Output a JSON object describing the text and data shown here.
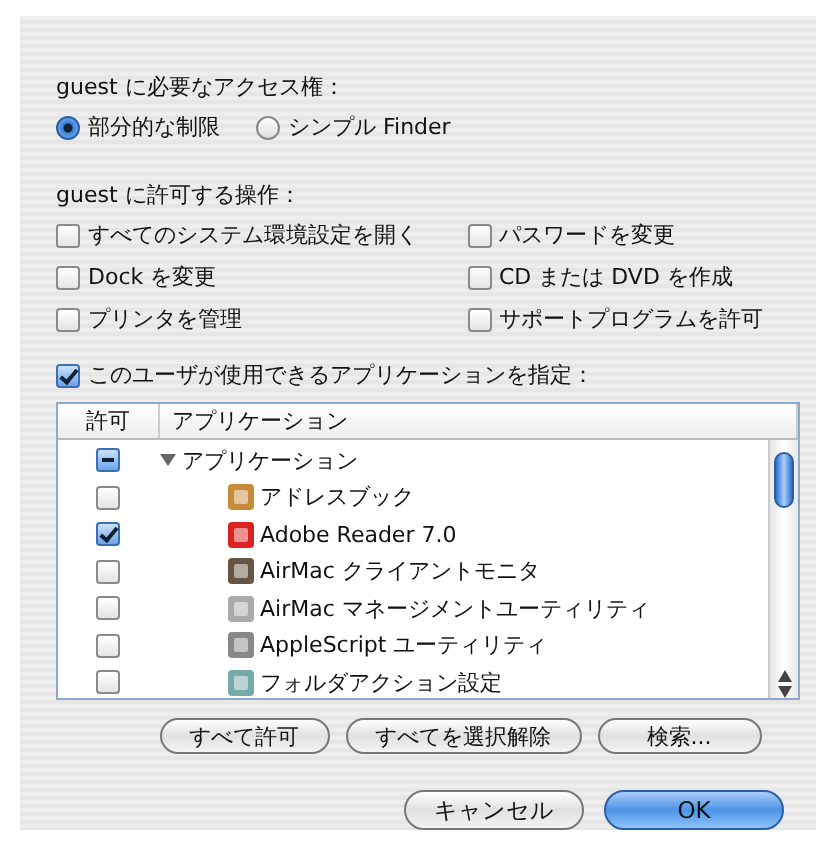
{
  "access": {
    "label": "guest に必要なアクセス権：",
    "options": [
      {
        "label": "部分的な制限",
        "selected": true
      },
      {
        "label": "シンプル Finder",
        "selected": false
      }
    ]
  },
  "permissions": {
    "label": "guest に許可する操作：",
    "items": [
      {
        "label": "すべてのシステム環境設定を開く",
        "checked": false
      },
      {
        "label": "パスワードを変更",
        "checked": false
      },
      {
        "label": "Dock を変更",
        "checked": false
      },
      {
        "label": "CD または DVD を作成",
        "checked": false
      },
      {
        "label": "プリンタを管理",
        "checked": false
      },
      {
        "label": "サポートプログラムを許可",
        "checked": false
      }
    ]
  },
  "restrict_apps": {
    "label": "このユーザが使用できるアプリケーションを指定：",
    "checked": true
  },
  "table": {
    "columns": [
      "許可",
      "アプリケーション"
    ],
    "rows": [
      {
        "name": "アプリケーション",
        "mixed": true,
        "expanded": true,
        "children": [
          {
            "name": "アドレスブック",
            "checked": false
          },
          {
            "name": "Adobe Reader 7.0",
            "checked": true
          },
          {
            "name": "AirMac クライアントモニタ",
            "checked": false
          },
          {
            "name": "AirMac マネージメントユーティリティ",
            "checked": false
          },
          {
            "name": "AppleScript ユーティリティ",
            "checked": false
          },
          {
            "name": "フォルダアクション設定",
            "checked": false
          }
        ]
      }
    ]
  },
  "table_buttons": [
    "すべて許可",
    "すべてを選択解除",
    "検索..."
  ],
  "dialog_buttons": [
    {
      "label": "キャンセル",
      "default": false
    },
    {
      "label": "OK",
      "default": true
    }
  ]
}
